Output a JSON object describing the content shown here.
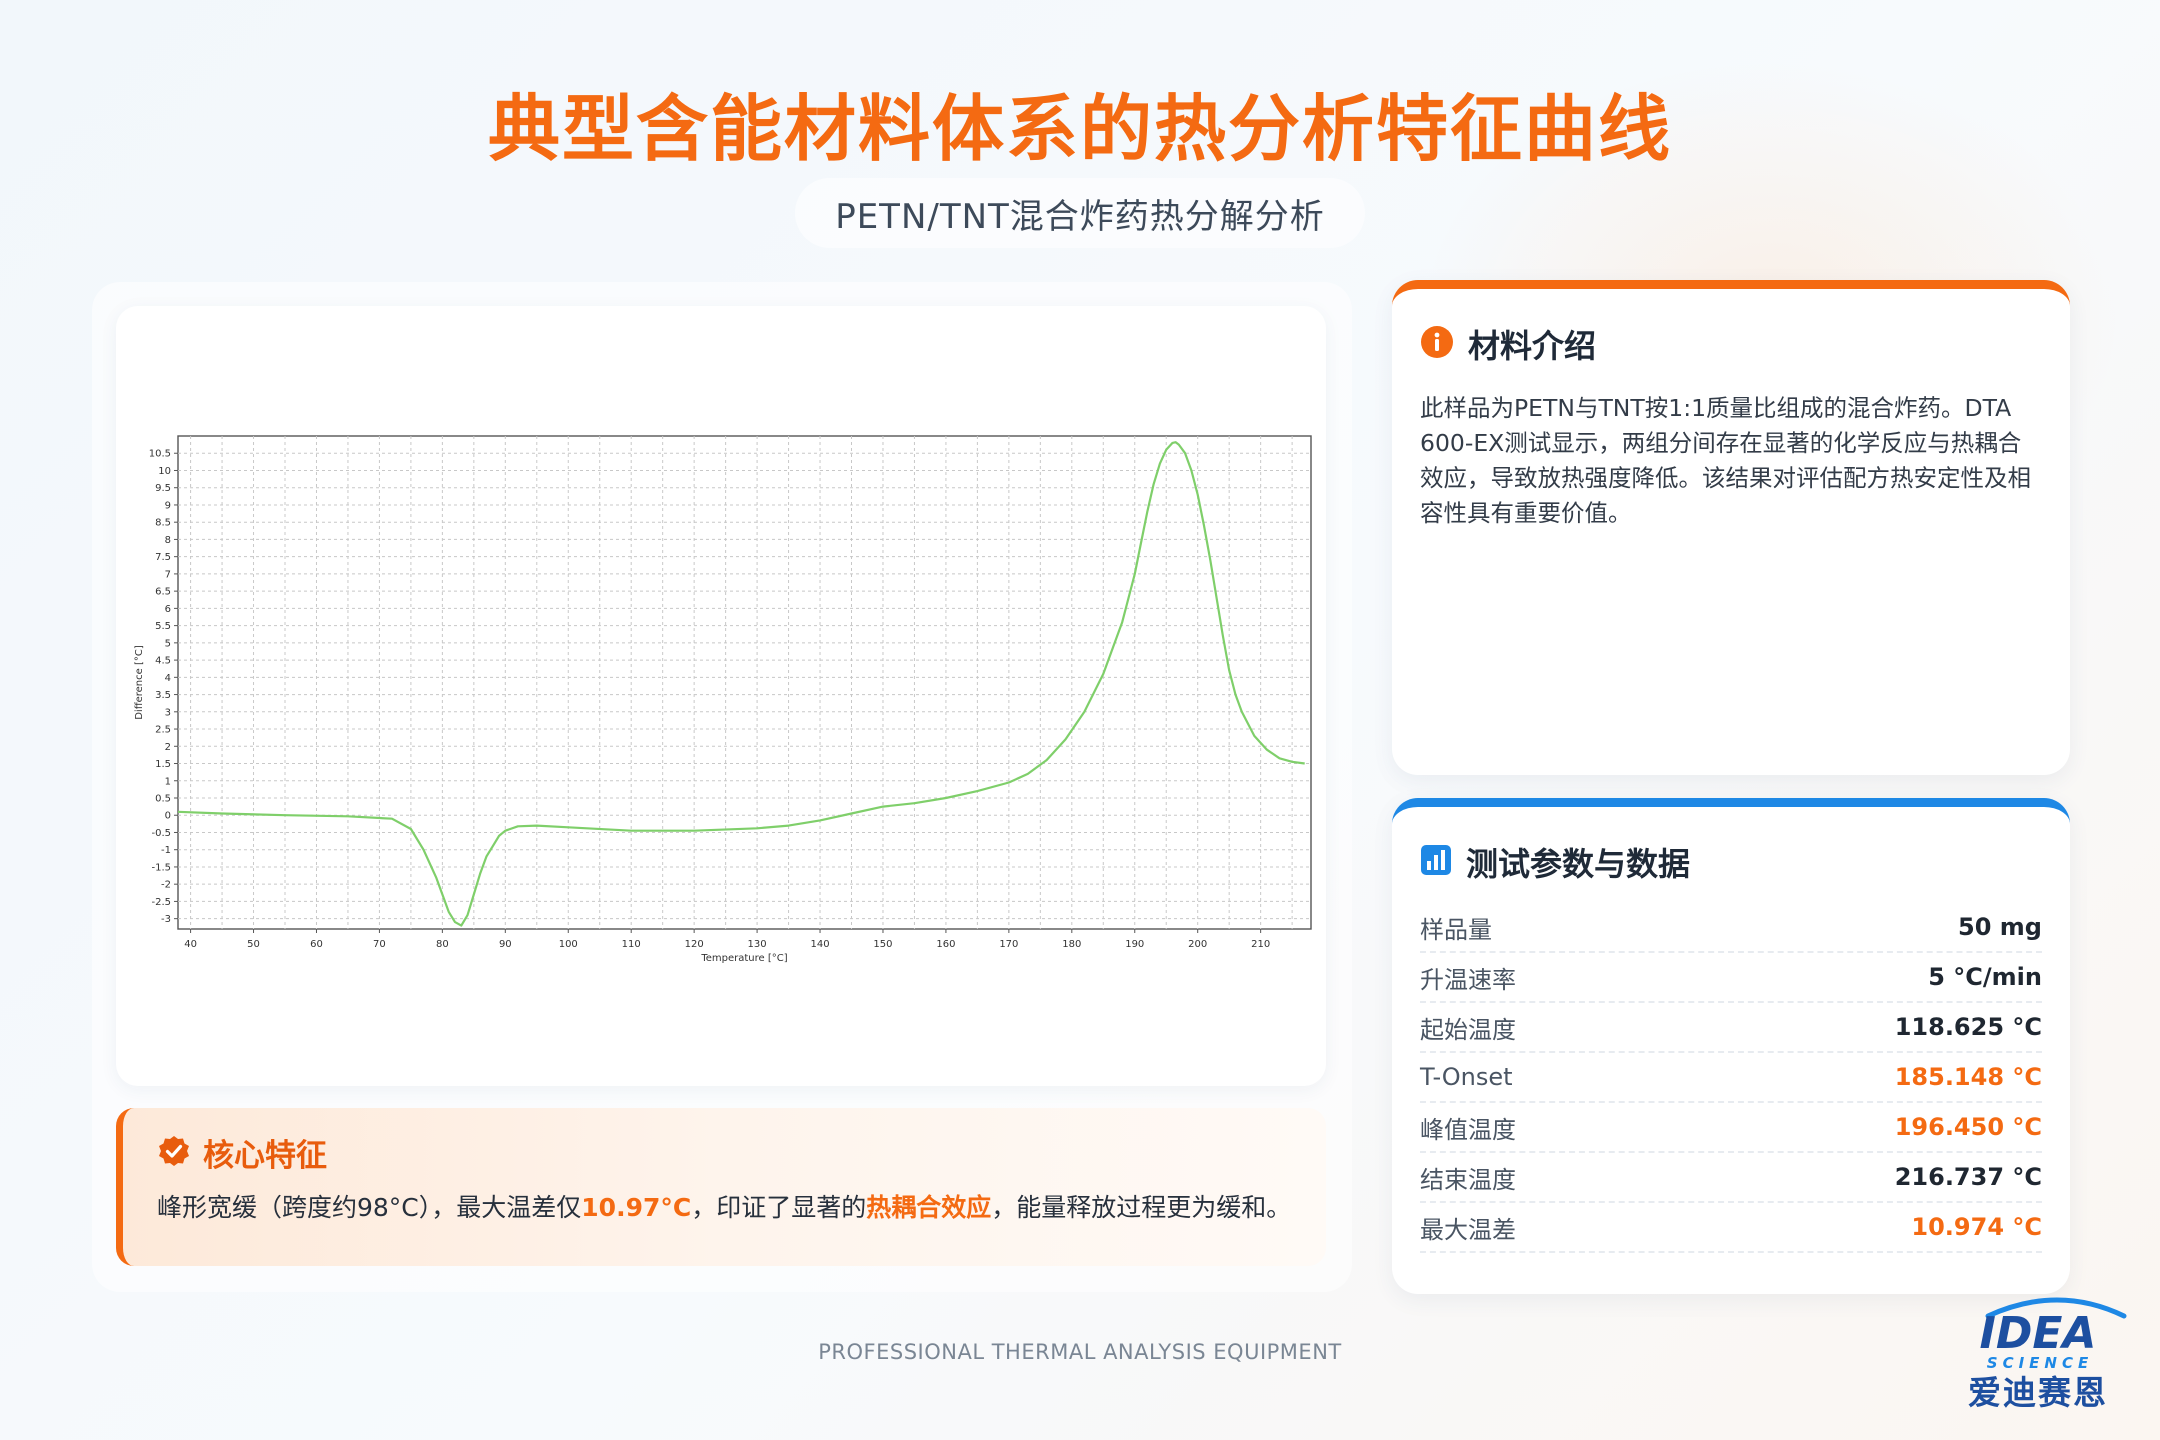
{
  "header": {
    "title": "典型含能材料体系的热分析特征曲线",
    "subtitle": "PETN/TNT混合炸药热分解分析"
  },
  "chart_data": {
    "type": "line",
    "xlabel": "Temperature [°C]",
    "ylabel": "Difference [°C]",
    "xlim": [
      38,
      218
    ],
    "ylim": [
      -3.3,
      11
    ],
    "xticks": [
      40,
      50,
      60,
      70,
      80,
      90,
      100,
      110,
      120,
      130,
      140,
      150,
      160,
      170,
      180,
      190,
      200,
      210
    ],
    "yticks": [
      "10.5",
      "10",
      "9.5",
      "9",
      "8.5",
      "8",
      "7.5",
      "7",
      "6.5",
      "6",
      "5.5",
      "5",
      "4.5",
      "4",
      "3.5",
      "3",
      "2.5",
      "2",
      "1.5",
      "1",
      "0.5",
      "0",
      "-0.5",
      "-1",
      "-1.5",
      "-2",
      "-2.5",
      "-3"
    ],
    "grid": true,
    "series": [
      {
        "color": "#7fcf6a",
        "x": [
          38,
          45,
          55,
          65,
          72,
          75,
          77,
          79,
          80,
          81,
          82,
          83,
          84,
          85,
          86,
          87,
          88,
          89,
          90,
          92,
          95,
          100,
          110,
          120,
          130,
          135,
          140,
          145,
          150,
          155,
          160,
          165,
          170,
          173,
          176,
          179,
          182,
          185,
          188,
          190,
          191,
          192,
          193,
          194,
          195,
          196,
          196.5,
          197,
          198,
          199,
          200,
          201,
          202,
          203,
          204,
          205,
          206,
          207,
          209,
          211,
          213,
          215,
          217
        ],
        "y": [
          0.1,
          0.05,
          0.0,
          -0.03,
          -0.1,
          -0.4,
          -1.0,
          -1.8,
          -2.3,
          -2.8,
          -3.1,
          -3.2,
          -2.9,
          -2.3,
          -1.7,
          -1.2,
          -0.9,
          -0.6,
          -0.45,
          -0.32,
          -0.3,
          -0.35,
          -0.45,
          -0.45,
          -0.38,
          -0.3,
          -0.15,
          0.05,
          0.25,
          0.35,
          0.5,
          0.7,
          0.95,
          1.2,
          1.6,
          2.2,
          3.0,
          4.1,
          5.6,
          7.0,
          7.9,
          8.8,
          9.6,
          10.2,
          10.6,
          10.8,
          10.82,
          10.75,
          10.5,
          10.0,
          9.3,
          8.4,
          7.4,
          6.3,
          5.2,
          4.2,
          3.5,
          3.0,
          2.3,
          1.9,
          1.65,
          1.55,
          1.5
        ]
      }
    ]
  },
  "feature": {
    "title": "核心特征",
    "text_1": "峰形宽缓（跨度约98°C），最大温差仅",
    "hl_1": "10.97°C",
    "text_2": "，印证了显著的",
    "hl_2": "热耦合效应",
    "text_3": "，能量释放过程更为缓和。"
  },
  "intro": {
    "title": "材料介绍",
    "text": "此样品为PETN与TNT按1:1质量比组成的混合炸药。DTA 600-EX测试显示，两组分间存在显著的化学反应与热耦合效应，导致放热强度降低。该结果对评估配方热安定性及相容性具有重要价值。"
  },
  "params": {
    "title": "测试参数与数据",
    "rows": [
      {
        "label": "样品量",
        "value": "50 mg"
      },
      {
        "label": "升温速率",
        "value": "5 °C/min"
      },
      {
        "label": "起始温度",
        "value": "118.625 °C"
      },
      {
        "label": "T-Onset",
        "value": "185.148 °C"
      },
      {
        "label": "峰值温度",
        "value": "196.450 °C"
      },
      {
        "label": "结束温度",
        "value": "216.737 °C"
      },
      {
        "label": "最大温差",
        "value": "10.974 °C"
      }
    ]
  },
  "footer": {
    "text": "PROFESSIONAL THERMAL ANALYSIS EQUIPMENT"
  },
  "logo": {
    "brand": "IDEA",
    "brand_sub": "SCIENCE",
    "cn_name": "爱迪赛恩"
  },
  "colors": {
    "accent_orange": "#f46a12",
    "accent_blue": "#1e88e5",
    "curve_green": "#7fcf6a"
  }
}
